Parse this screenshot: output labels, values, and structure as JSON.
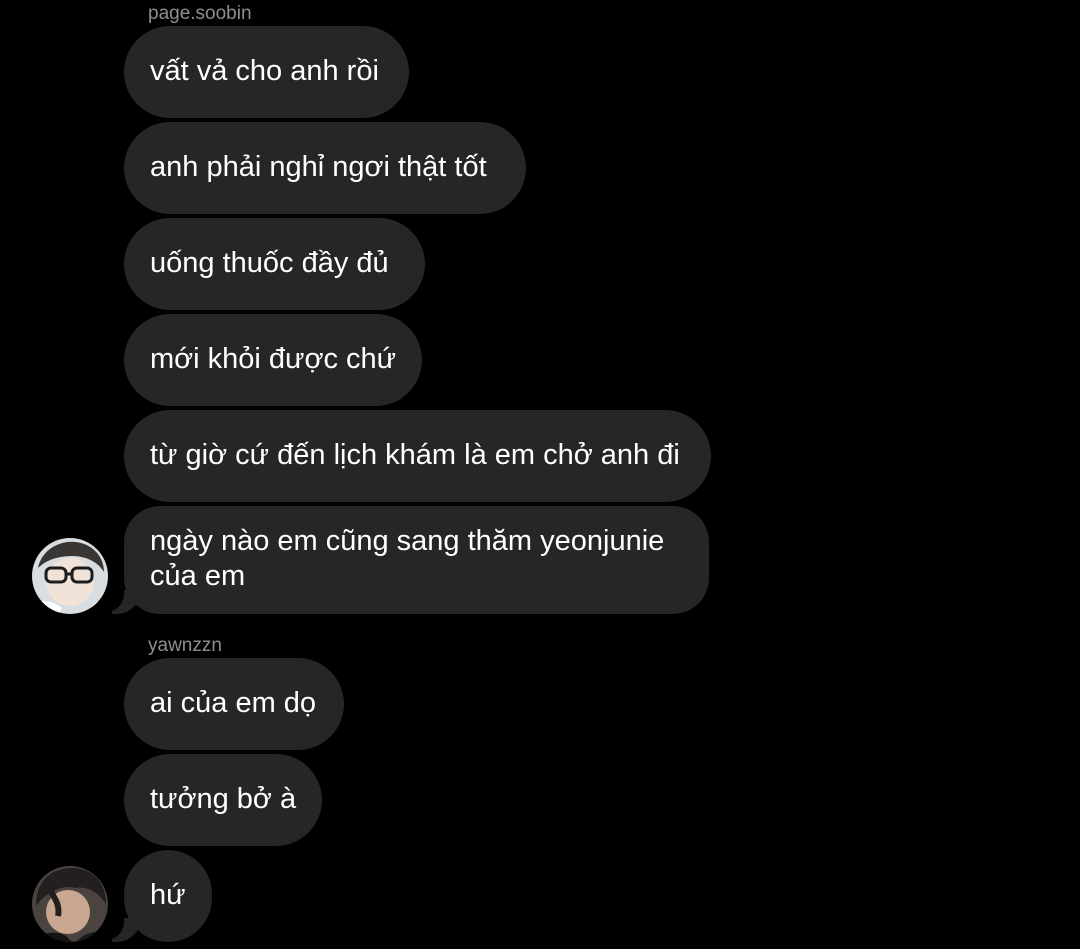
{
  "conversation": {
    "groups": [
      {
        "sender": "page.soobin",
        "messages": [
          "vất vả cho anh rồi",
          "anh phải nghỉ ngơi thật tốt",
          "uống thuốc đầy đủ",
          "mới khỏi được chứ",
          "từ giờ cứ đến lịch khám là em chở anh đi",
          "ngày nào em cũng sang thăm yeonjunie của em"
        ]
      },
      {
        "sender": "yawnzzn",
        "messages": [
          "ai của em dọ",
          "tưởng bở à",
          "hứ"
        ]
      }
    ]
  },
  "colors": {
    "background": "#000000",
    "bubble": "#262628",
    "text": "#ffffff",
    "sender_name": "#8e8e93"
  },
  "icons": {
    "avatar_1": "user-avatar-photo",
    "avatar_2": "user-avatar-photo"
  }
}
